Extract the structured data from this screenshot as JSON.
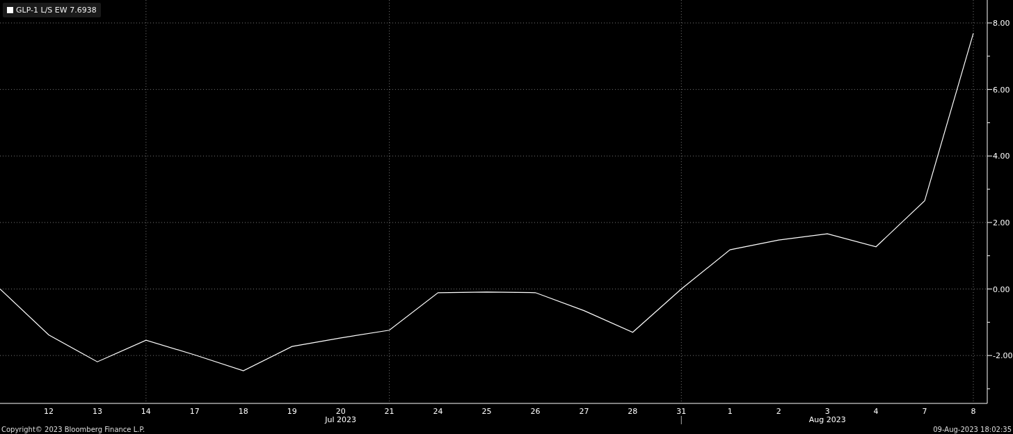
{
  "chart": {
    "legend": {
      "value": "7.6938"
    },
    "period_labels": [
      "Jul 2023",
      "Aug 2023"
    ],
    "chart_data": {
      "type": "line",
      "categories": [
        null,
        "12",
        "13",
        "14",
        "17",
        "18",
        "19",
        "20",
        "21",
        "24",
        "25",
        "26",
        "27",
        "28",
        "31",
        "1",
        "2",
        "3",
        "4",
        "7",
        "8"
      ],
      "series": [
        {
          "name": "GLP-1 L/S EW",
          "color": "#ffffff",
          "values": [
            0.0,
            -1.38,
            -2.19,
            -1.54,
            -1.98,
            -2.46,
            -1.73,
            -1.47,
            -1.24,
            -0.11,
            -0.09,
            -0.11,
            -0.65,
            -1.3,
            0.0,
            1.18,
            1.47,
            1.66,
            1.27,
            2.65,
            7.69
          ]
        }
      ],
      "ylim": [
        -3.44,
        8.69
      ],
      "yticks": [
        {
          "value": -2,
          "label": "-2.00"
        },
        {
          "value": 0,
          "label": "0.00"
        },
        {
          "value": 2,
          "label": "2.00"
        },
        {
          "value": 4,
          "label": "4.00"
        },
        {
          "value": 6,
          "label": "6.00"
        },
        {
          "value": 8,
          "label": "8.00"
        }
      ],
      "grid": true
    }
  },
  "footer": {
    "copyright": "Copyright© 2023 Bloomberg Finance L.P.",
    "timestamp": "09-Aug-2023 18:02:35"
  }
}
